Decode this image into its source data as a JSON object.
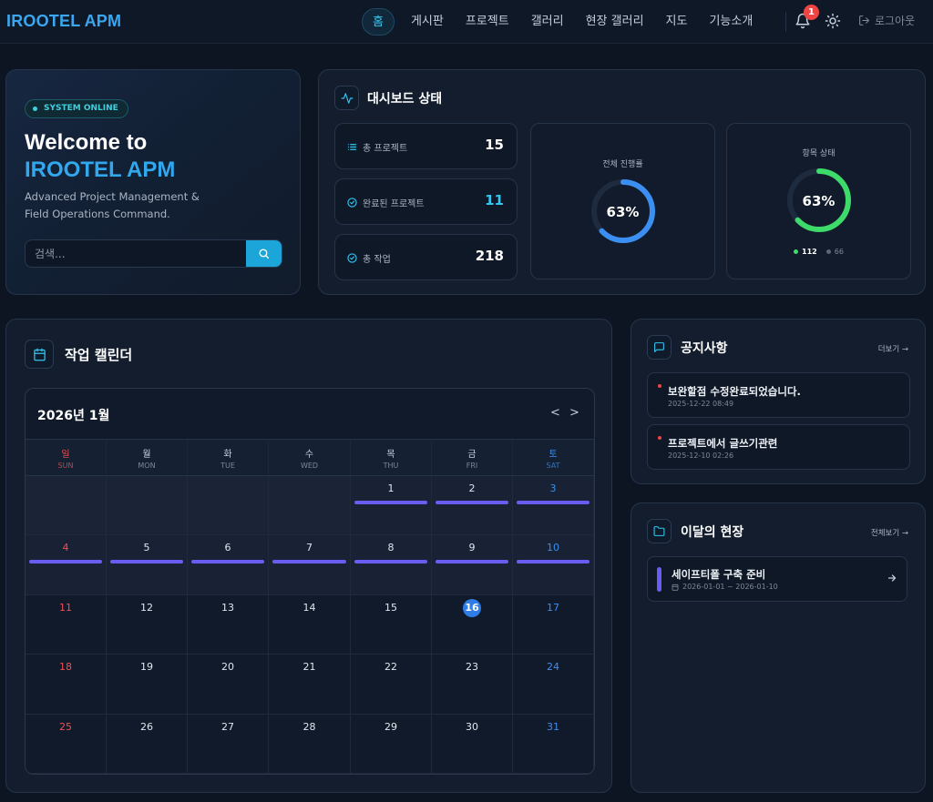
{
  "header": {
    "logo": "IROOTEL APM",
    "nav": [
      "홈",
      "게시판",
      "프로젝트",
      "갤러리",
      "현장 갤러리",
      "지도",
      "기능소개"
    ],
    "notification_count": "1",
    "logout_label": "로그아웃",
    "icons": {
      "bell": "bell-icon",
      "theme": "sun-icon",
      "logout": "logout-icon"
    }
  },
  "welcome": {
    "status": "SYSTEM ONLINE",
    "title_line1": "Welcome to",
    "title_line2": "IROOTEL APM",
    "subtitle_line1": "Advanced Project Management &",
    "subtitle_line2": "Field Operations Command.",
    "search_placeholder": "검색..."
  },
  "dashboard": {
    "title": "대시보드 상태",
    "stats": [
      {
        "label": "총 프로젝트",
        "value": "15"
      },
      {
        "label": "완료된 프로젝트",
        "value": "11"
      },
      {
        "label": "총 작업",
        "value": "218"
      }
    ],
    "overall": {
      "label": "전체 진행률",
      "value": "63%",
      "progress": 0.63
    },
    "items": {
      "label": "항목 상태",
      "value": "63%",
      "progress": 0.63,
      "done": "112",
      "remaining": "66"
    },
    "colors": {
      "accent": "#31a8ee",
      "done": "#3ddc6a",
      "highlight": "#34c6f0"
    }
  },
  "calendar": {
    "title": "작업 캘린더",
    "month": "2026년 1월",
    "prev": "<",
    "next": ">",
    "weekdays": [
      {
        "ko": "일",
        "en": "SUN"
      },
      {
        "ko": "월",
        "en": "MON"
      },
      {
        "ko": "화",
        "en": "TUE"
      },
      {
        "ko": "수",
        "en": "WED"
      },
      {
        "ko": "목",
        "en": "THU"
      },
      {
        "ko": "금",
        "en": "FRI"
      },
      {
        "ko": "토",
        "en": "SAT"
      }
    ],
    "leading_blanks": 4,
    "days": 31,
    "today": 16,
    "event_color": "#6a5cf0"
  },
  "notices": {
    "title": "공지사항",
    "more": "더보기",
    "items": [
      {
        "title": "보완할점 수정완료되었습니다.",
        "date": "2025-12-22 08:49"
      },
      {
        "title": "프로젝트에서 글쓰기관련",
        "date": "2025-12-10 02:26"
      }
    ]
  },
  "sites": {
    "title": "이달의 현장",
    "more": "전체보기",
    "items": [
      {
        "title": "세이프티폴 구축 준비",
        "period": "2026-01-01 ~ 2026-01-10"
      }
    ]
  }
}
